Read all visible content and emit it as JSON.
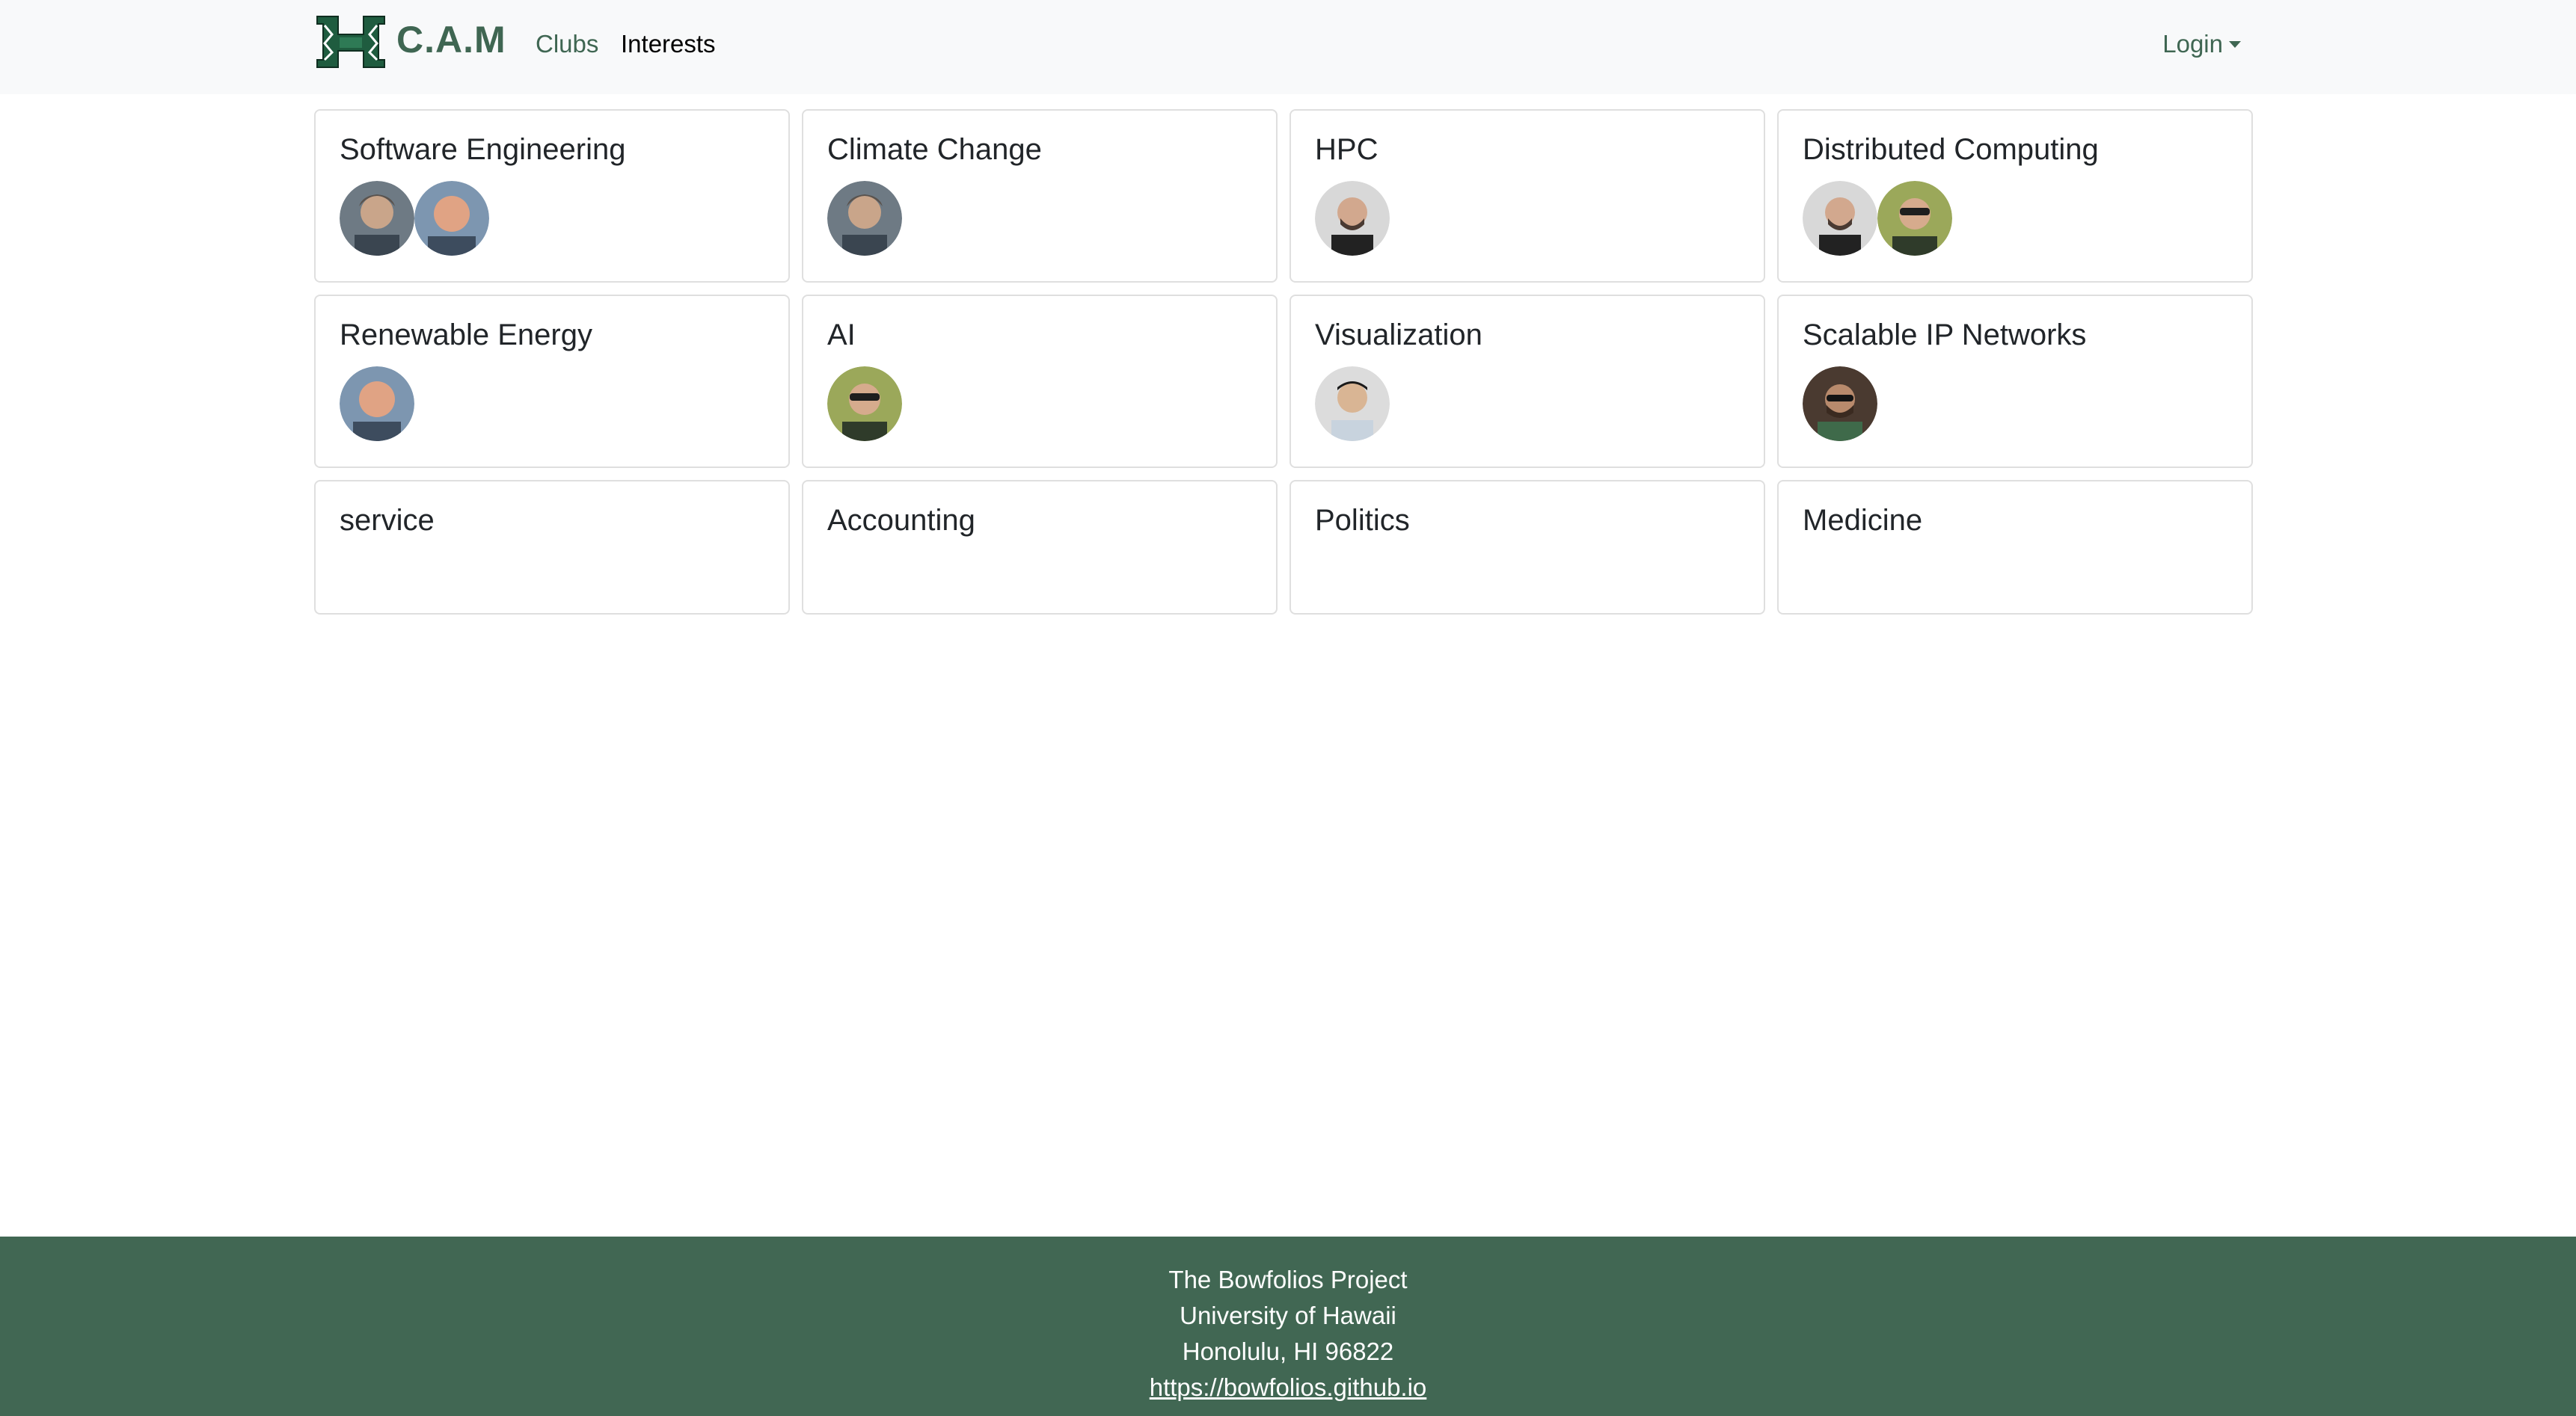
{
  "nav": {
    "brand": "C.A.M",
    "links": [
      {
        "label": "Clubs"
      },
      {
        "label": "Interests"
      }
    ],
    "login_label": "Login"
  },
  "interests": [
    {
      "title": "Software Engineering",
      "avatars": 2
    },
    {
      "title": "Climate Change",
      "avatars": 1
    },
    {
      "title": "HPC",
      "avatars": 1
    },
    {
      "title": "Distributed Computing",
      "avatars": 2
    },
    {
      "title": "Renewable Energy",
      "avatars": 1
    },
    {
      "title": "AI",
      "avatars": 1
    },
    {
      "title": "Visualization",
      "avatars": 1
    },
    {
      "title": "Scalable IP Networks",
      "avatars": 1
    },
    {
      "title": "service",
      "avatars": 0
    },
    {
      "title": "Accounting",
      "avatars": 0
    },
    {
      "title": "Politics",
      "avatars": 0
    },
    {
      "title": "Medicine",
      "avatars": 0
    }
  ],
  "footer": {
    "line1": "The Bowfolios Project",
    "line2": "University of Hawaii",
    "line3": "Honolulu, HI 96822",
    "link": "https://bowfolios.github.io"
  },
  "colors": {
    "brand_green": "#3f6652",
    "footer_green": "#416753",
    "navbar_bg": "#f8f9fa"
  }
}
